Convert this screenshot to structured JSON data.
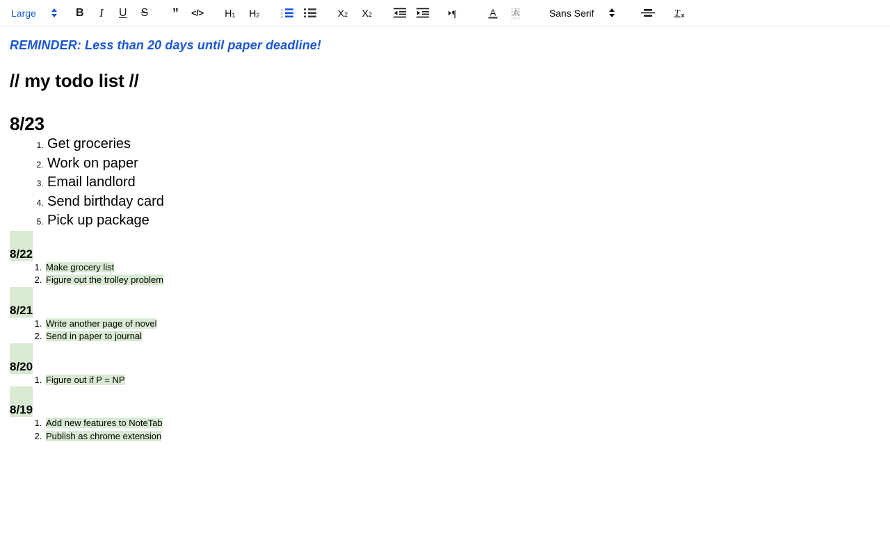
{
  "toolbar": {
    "font_size_select": {
      "value": "Large",
      "name": "font-size-select"
    },
    "font_family_select": {
      "value": "Sans Serif",
      "name": "font-family-select"
    },
    "buttons": [
      {
        "name": "bold-icon",
        "glyph": "B",
        "label": "Bold"
      },
      {
        "name": "italic-icon",
        "glyph": "I",
        "label": "Italic"
      },
      {
        "name": "underline-icon",
        "glyph": "U",
        "label": "Underline"
      },
      {
        "name": "strikethrough-icon",
        "glyph": "S",
        "label": "Strikethrough"
      },
      {
        "name": "blockquote-icon",
        "glyph": "”",
        "label": "Blockquote"
      },
      {
        "name": "code-icon",
        "glyph": "</>",
        "label": "Code"
      },
      {
        "name": "heading-1-icon",
        "glyph": "H",
        "sub": "1",
        "label": "Heading 1"
      },
      {
        "name": "heading-2-icon",
        "glyph": "H",
        "sub": "2",
        "label": "Heading 2"
      },
      {
        "name": "ordered-list-icon",
        "label": "Numbered list",
        "active": true
      },
      {
        "name": "unordered-list-icon",
        "label": "Bulleted list",
        "active": false
      },
      {
        "name": "subscript-icon",
        "glyph": "X",
        "sub": "2",
        "label": "Subscript"
      },
      {
        "name": "superscript-icon",
        "glyph": "X",
        "sup": "2",
        "label": "Superscript"
      },
      {
        "name": "outdent-icon",
        "label": "Decrease indent"
      },
      {
        "name": "indent-icon",
        "label": "Increase indent"
      },
      {
        "name": "text-direction-icon",
        "glyph": "¶",
        "label": "Text direction"
      },
      {
        "name": "text-color-icon",
        "glyph": "A",
        "label": "Text color"
      },
      {
        "name": "highlight-color-icon",
        "glyph": "A",
        "label": "Highlight color"
      },
      {
        "name": "align-icon",
        "label": "Align"
      },
      {
        "name": "clear-formatting-icon",
        "glyph": "T",
        "sub": "x",
        "label": "Clear formatting"
      }
    ],
    "colors": {
      "accent_blue": "#1a56d6",
      "icon_gray": "#1a1a1a",
      "border": "#e3e3e3"
    }
  },
  "document": {
    "reminder": "REMINDER: Less than 20 days until paper deadline!",
    "title": "// my todo list //",
    "highlight_color": "#d9ead3",
    "sections": [
      {
        "date": "8/23",
        "highlighted": false,
        "size": "large",
        "items": [
          "Get groceries",
          "Work on paper",
          "Email landlord",
          "Send birthday card",
          "Pick up package"
        ]
      },
      {
        "date": "8/22",
        "highlighted": true,
        "size": "small",
        "items": [
          "Make grocery list",
          "Figure out the trolley problem"
        ]
      },
      {
        "date": "8/21",
        "highlighted": true,
        "size": "small",
        "items": [
          "Write another page of novel",
          "Send in paper to journal"
        ]
      },
      {
        "date": "8/20",
        "highlighted": true,
        "size": "small",
        "items": [
          "Figure out if P = NP"
        ]
      },
      {
        "date": "8/19",
        "highlighted": true,
        "size": "small",
        "items": [
          "Add new features to NoteTab",
          "Publish as chrome extension"
        ]
      }
    ]
  }
}
